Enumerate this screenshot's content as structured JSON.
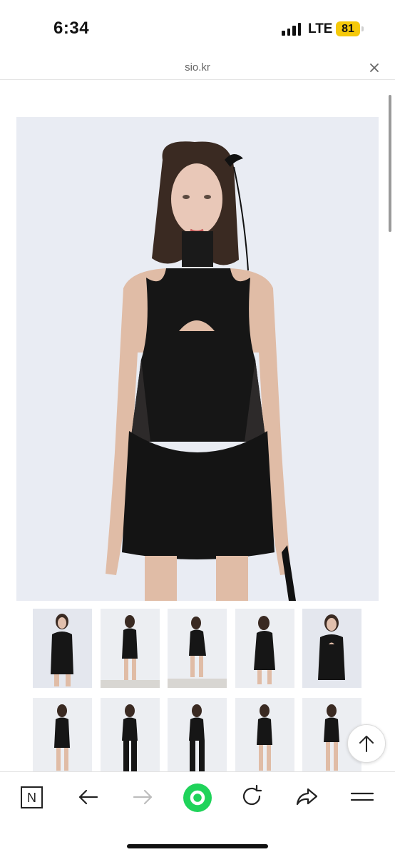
{
  "status_bar": {
    "time": "6:34",
    "network": "LTE",
    "battery": "81"
  },
  "browser": {
    "url": "sio.kr"
  },
  "colors": {
    "battery": "#f5c90a",
    "green_button": "#1fd35a",
    "photo_background": "#e9ecf3"
  },
  "icons": {
    "close": "close-icon",
    "scroll_top": "arrow-up-icon",
    "naver": "naver-n-icon",
    "back": "arrow-left-icon",
    "forward": "arrow-right-icon",
    "green": "green-circle-icon",
    "reload": "reload-icon",
    "share": "share-icon",
    "menu": "menu-icon"
  },
  "toolbar": {
    "naver_letter": "N"
  },
  "gallery": {
    "thumbnail_count": 10
  }
}
